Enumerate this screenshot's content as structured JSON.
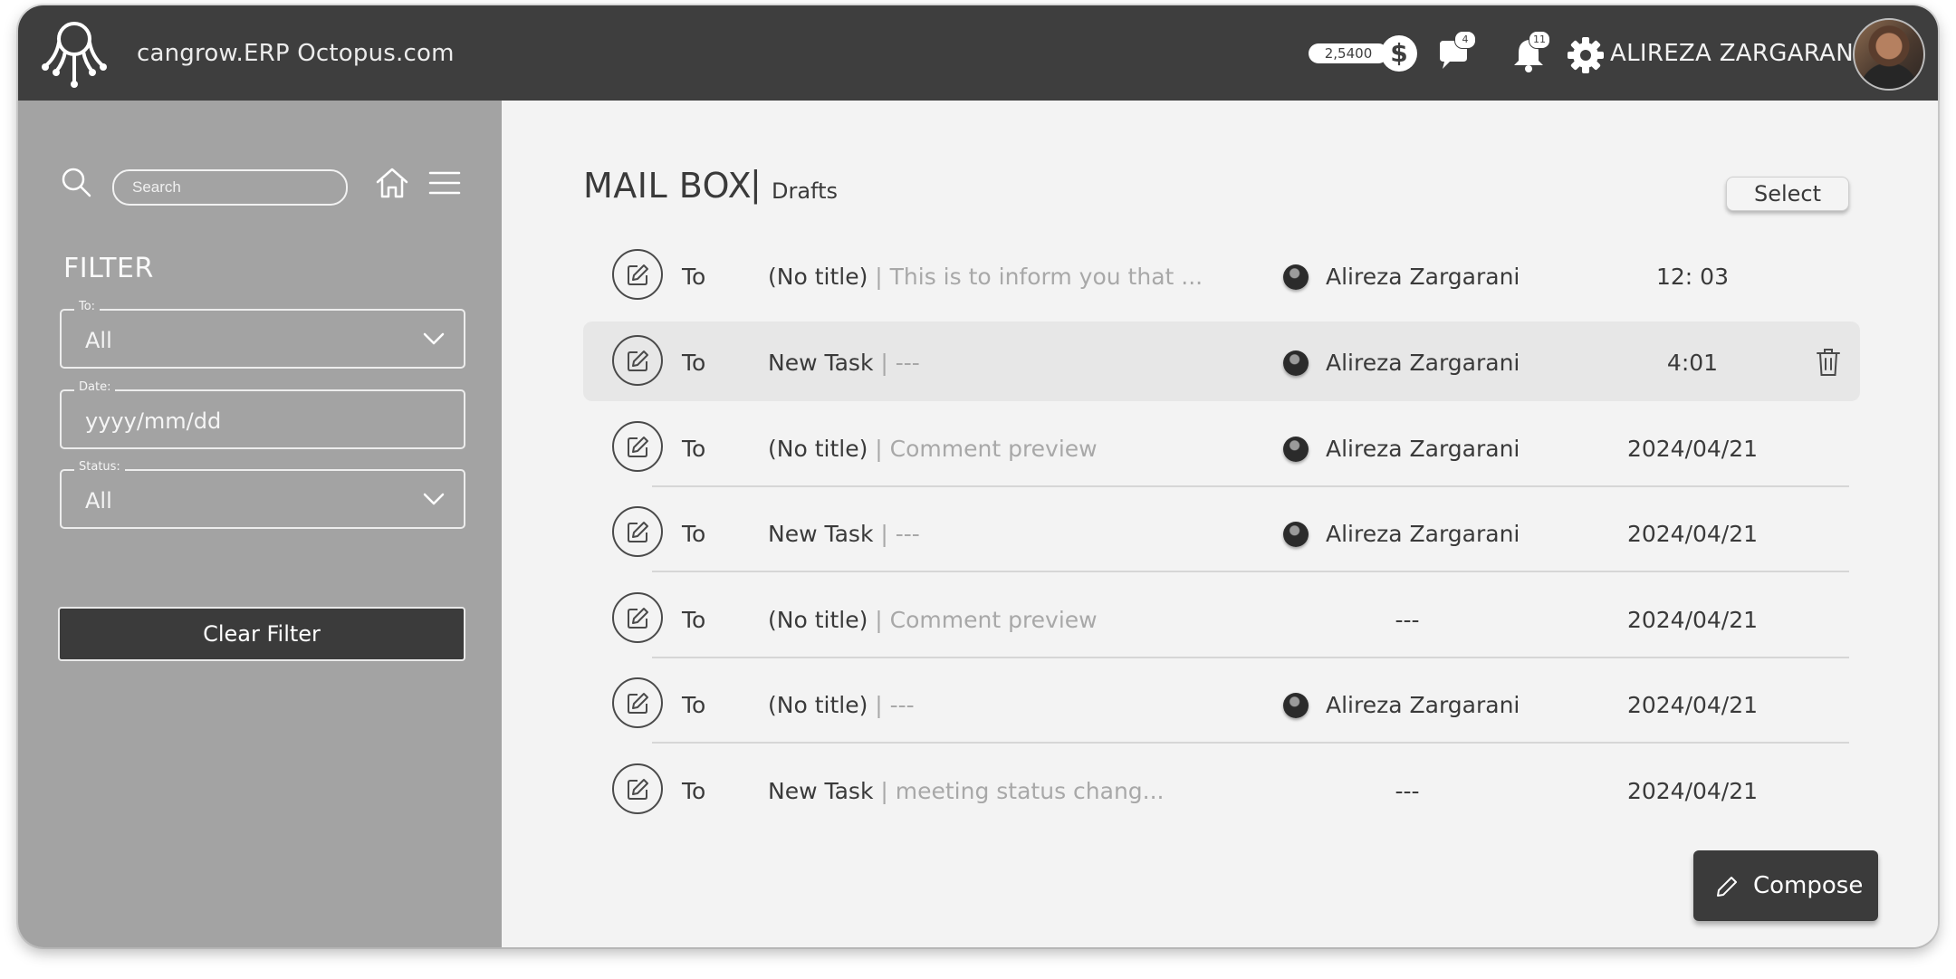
{
  "header": {
    "app_title": "cangrow.ERP Octopus.com",
    "balance": "2,5400",
    "currency_symbol": "$",
    "messages_badge": "4",
    "notifications_badge": "11",
    "user_name": "ALIREZA ZARGARANI"
  },
  "sidebar": {
    "search_placeholder": "Search",
    "filter_title": "FILTER",
    "filters": [
      {
        "label": "To:",
        "value": "All"
      },
      {
        "label": "Date:",
        "value": "yyyy/mm/dd"
      },
      {
        "label": "Status:",
        "value": "All"
      }
    ],
    "clear_filter_label": "Clear Filter"
  },
  "main": {
    "title": "MAIL BOX",
    "separator": "|",
    "subtitle": "Drafts",
    "select_label": "Select",
    "compose_label": "Compose",
    "rows": [
      {
        "to": "To",
        "subject": "(No title)",
        "preview": " | This is to inform you that ...",
        "sender": "Alireza Zargarani",
        "time": "12: 03"
      },
      {
        "to": "To",
        "subject": "New Task",
        "preview": " | ---",
        "sender": "Alireza Zargarani",
        "time": "4:01"
      },
      {
        "to": "To",
        "subject": "(No title)",
        "preview": " | Comment preview",
        "sender": "Alireza Zargarani",
        "time": "2024/04/21"
      },
      {
        "to": "To",
        "subject": "New Task",
        "preview": " | ---",
        "sender": "Alireza Zargarani",
        "time": "2024/04/21"
      },
      {
        "to": "To",
        "subject": "(No title)",
        "preview": " | Comment preview",
        "sender": "---",
        "time": "2024/04/21"
      },
      {
        "to": "To",
        "subject": "(No title)",
        "preview": " | ---",
        "sender": "Alireza Zargarani",
        "time": "2024/04/21"
      },
      {
        "to": "To",
        "subject": "New Task",
        "preview": " | meeting status chang...",
        "sender": "---",
        "time": "2024/04/21"
      }
    ]
  },
  "colors": {
    "topbar": "#3e3e3e",
    "sidebar": "#a3a3a3",
    "main_bg": "#f3f3f3",
    "highlight_row": "#e7e7e7",
    "dark_button": "#3b3b3b"
  }
}
